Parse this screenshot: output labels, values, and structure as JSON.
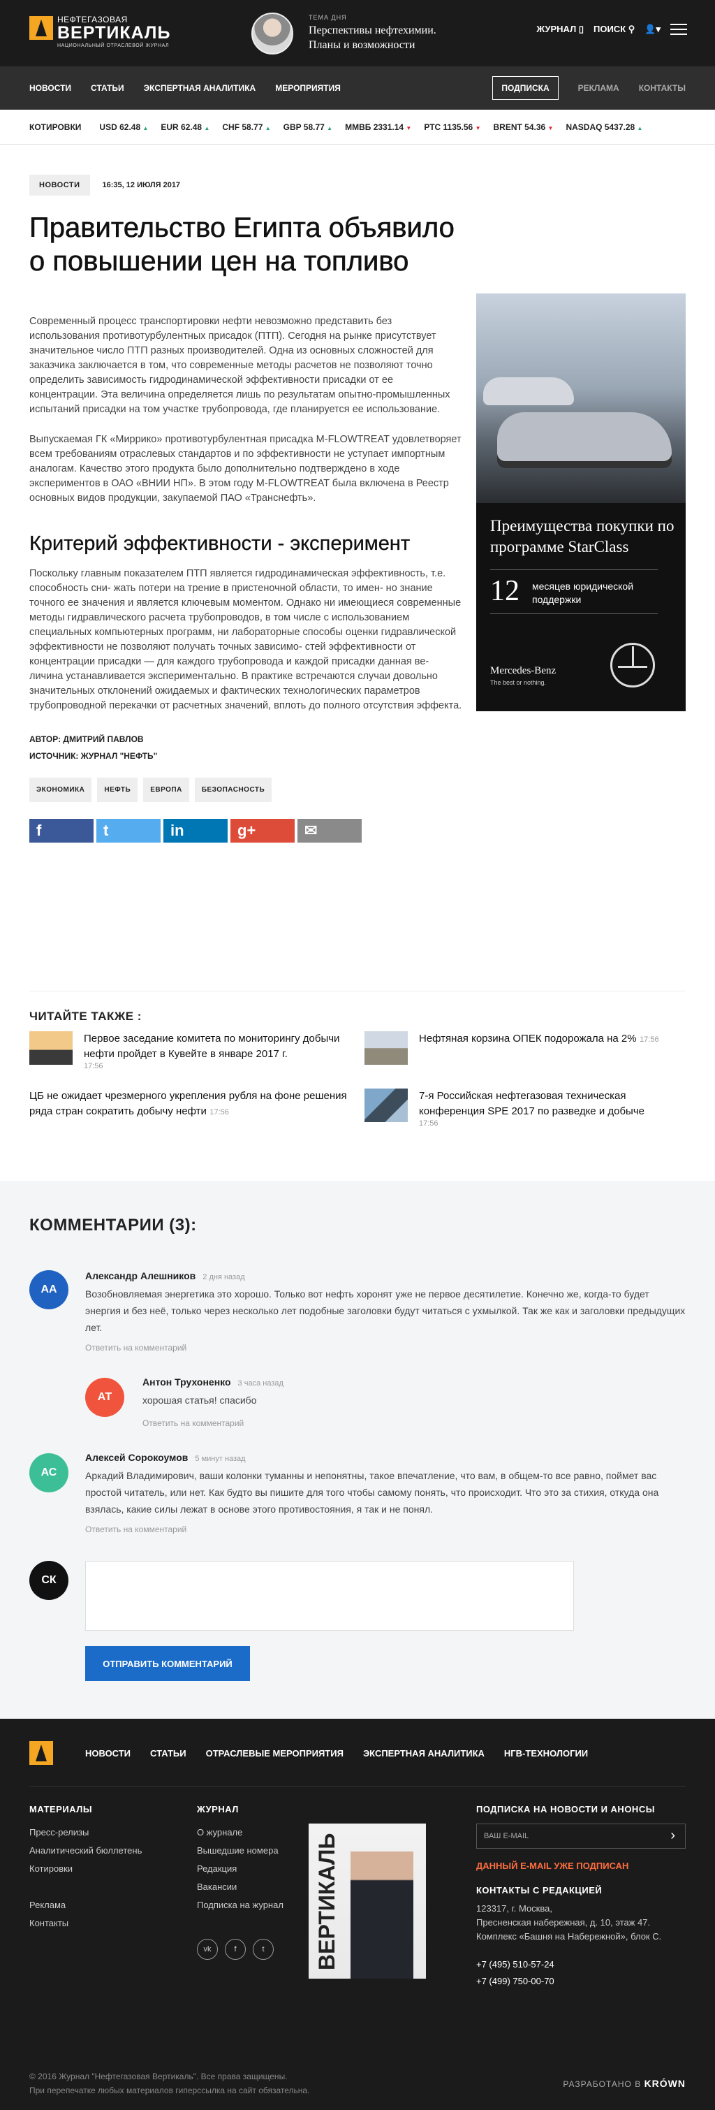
{
  "header": {
    "logo": {
      "line1": "НЕФТЕГАЗОВАЯ",
      "line2": "ВЕРТИКАЛЬ",
      "line3": "НАЦИОНАЛЬНЫЙ ОТРАСЛЕВОЙ ЖУРНАЛ"
    },
    "theme_label": "ТЕМА ДНЯ",
    "theme_text": "Перспективы нефтехимии. Планы и возможности",
    "journal": "ЖУРНАЛ",
    "search": "ПОИСК",
    "user_caret": "▾"
  },
  "nav": {
    "items": [
      "НОВОСТИ",
      "СТАТЬИ",
      "ЭКСПЕРТНАЯ АНАЛИТИКА",
      "МЕРОПРИЯТИЯ"
    ],
    "subscribe": "ПОДПИСКА",
    "ads": "РЕКЛАМА",
    "contacts": "КОНТАКТЫ"
  },
  "ticker": {
    "label": "КОТИРОВКИ",
    "items": [
      {
        "text": "USD 62.48",
        "dir": "▲",
        "up": true
      },
      {
        "text": "EUR 62.48",
        "dir": "▲",
        "up": true
      },
      {
        "text": "CHF 58.77",
        "dir": "▲",
        "up": true
      },
      {
        "text": "GBP 58.77",
        "dir": "▲",
        "up": true
      },
      {
        "text": "ММВБ 2331.14",
        "dir": "▼",
        "up": false
      },
      {
        "text": "РТС 1135.56",
        "dir": "▼",
        "up": false
      },
      {
        "text": "BRENT 54.36",
        "dir": "▼",
        "up": false
      },
      {
        "text": "NASDAQ 5437.28",
        "dir": "▲",
        "up": true
      }
    ]
  },
  "article": {
    "tag": "НОВОСТИ",
    "date": "16:35, 12 ИЮЛЯ 2017",
    "title": "Правительство Египта объявило о повышении цен на топливо",
    "p1": "Современный процесс транспортировки нефти невозможно представить без использования противотурбулентных присадок (ПТП). Сегодня на рынке присутствует значительное число ПТП разных производителей. Одна из основных сложностей для заказчика заключается в том, что современные методы расчетов не позволяют точно определить зависимость гидродинамической эффективности присадки от ее концентрации. Эта величина определяется лишь по результатам опытно-промышленных испытаний присадки на том участке трубопровода, где планируется ее использование.",
    "p2": "Выпускаемая ГК «Миррико» противотурбулентная присадка M-FLOWTREAT удовлетворяет всем требованиям отраслевых стандартов и по эффективности не уступает импортным аналогам. Качество этого продукта было дополнительно подтверждено в ходе экспериментов в ОАО «ВНИИ НП». В этом году M-FLOWTREAT была включена в Реестр основных видов продукции, закупаемой ПАО «Транснефть».",
    "h2": "Критерий эффективности - эксперимент",
    "p3": "Поскольку главным показателем ПТП является гидродинамическая эффективность, т.е. способность сни- жать потери на трение в пристеночной области, то имен- но знание точного ее значения и является ключевым моментом. Однако ни имеющиеся современные методы гидравлического расчета трубопроводов, в том числе с использованием специальных компьютерных программ, ни лабораторные способы оценки гидравлической эффективности не позволяют получать точных зависимо- стей эффективности от концентрации присадки — для каждого трубопровода и каждой присадки данная ве- личина устанавливается экспериментально. В практике встречаются случаи довольно значительных отклонений ожидаемых и фактических технологических параметров трубопроводной перекачки от расчетных значений, вплоть до полного отсутствия эффекта.",
    "author": "АВТОР: ДМИТРИЙ ПАВЛОВ",
    "source": "ИСТОЧНИК: ЖУРНАЛ \"НЕФТЬ\"",
    "tags": [
      "ЭКОНОМИКА",
      "НЕФТЬ",
      "ЕВРОПА",
      "БЕЗОПАСНОСТЬ"
    ],
    "shares": [
      {
        "glyph": "f",
        "color": "#3b5998"
      },
      {
        "glyph": "t",
        "color": "#55acee"
      },
      {
        "glyph": "in",
        "color": "#0077b5"
      },
      {
        "glyph": "g+",
        "color": "#dd4b39"
      },
      {
        "glyph": "✉",
        "color": "#8a8a8a"
      }
    ]
  },
  "ad": {
    "title": "Преимущества покупки по программе StarClass",
    "number": "12",
    "number_text": "месяцев юридической поддержки",
    "brand": "Mercedes-Benz",
    "slogan": "The best or nothing."
  },
  "read_also": {
    "title": "ЧИТАЙТЕ ТАКЖЕ :",
    "items": [
      {
        "title": "Первое заседание комитета по мониторингу добычи нефти пройдет в Кувейте в январе 2017 г.",
        "time": "17:56"
      },
      {
        "title": "Нефтяная корзина ОПЕК подорожала на 2%",
        "time": "17:56"
      },
      {
        "title": "ЦБ не ожидает чрезмерного укрепления рубля на фоне решения ряда стран сократить добычу нефти",
        "time": "17:56"
      },
      {
        "title": "7-я Российская нефтегазовая техническая конференция SPE 2017 по разведке и добыче",
        "time": "17:56"
      }
    ]
  },
  "comments": {
    "title": "КОММЕНТАРИИ (3):",
    "reply": "Ответить на комментарий",
    "list": [
      {
        "initials": "АА",
        "name": "Александр Алешников",
        "time": "2 дня назад",
        "text": "Возобновляемая энергетика это хорошо. Только вот нефть хоронят уже не первое десятилетие. Конечно же, когда-то будет энергия и без неё, только через несколько лет подобные заголовки будут читаться с ухмылкой. Так же как и заголовки предыдущих лет.",
        "color": "#1f62c2"
      },
      {
        "initials": "АТ",
        "name": "Антон Трухоненко",
        "time": "3 часа назад",
        "text": "хорошая статья! спасибо",
        "color": "#f0543c"
      },
      {
        "initials": "АС",
        "name": "Алексей Сорокоумов",
        "time": "5 минут назад",
        "text": "Аркадий Владимирович, ваши колонки туманны и непонятны, такое впечатление, что вам, в общем-то все равно, поймет вас простой читатель, или нет. Как будто вы пишите для того чтобы самому понять, что происходит. Что это за стихия, откуда она взялась, какие силы лежат в основе этого противостояния, я так и не понял.",
        "color": "#3cbf96"
      }
    ],
    "me_initials": "СК",
    "submit": "ОТПРАВИТЬ КОММЕНТАРИЙ"
  },
  "footer": {
    "nav": [
      "НОВОСТИ",
      "СТАТЬИ",
      "ОТРАСЛЕВЫЕ МЕРОПРИЯТИЯ",
      "ЭКСПЕРТНАЯ АНАЛИТИКА",
      "НГВ-ТЕХНОЛОГИИ"
    ],
    "materials_title": "МАТЕРИАЛЫ",
    "materials": [
      "Пресс-релизы",
      "Аналитический бюллетень",
      "Котировки"
    ],
    "materials2": [
      "Реклама",
      "Контакты"
    ],
    "journal_title": "ЖУРНАЛ",
    "journal": [
      "О журнале",
      "Вышедшие номера",
      "Редакция",
      "Вакансии",
      "Подписка на журнал"
    ],
    "social": [
      "vk",
      "f",
      "t"
    ],
    "magazine_title": "ВЕРТИКАЛЬ",
    "subscribe_title": "ПОДПИСКА НА НОВОСТИ И АНОНСЫ",
    "email_placeholder": "ВАШ E-MAIL",
    "email_error": "ДАННЫЙ E-MAIL УЖЕ ПОДПИСАН",
    "contacts_title": "КОНТАКТЫ С РЕДАКЦИЕЙ",
    "address": [
      "123317, г. Москва,",
      "Пресненская набережная, д. 10, этаж 47.",
      "Комплекс «Башня на Набережной», блок С."
    ],
    "phones": [
      "+7 (495) 510-57-24",
      "+7 (499) 750-00-70"
    ],
    "copyright": "© 2016 Журнал \"Нефтегазовая Вертикаль\". Все права защищены.",
    "copy2": "При перепечатке любых материалов гиперссылка на сайт обязательна.",
    "dev_label": "РАЗРАБОТАНО В",
    "dev_brand": "KRÓWN"
  }
}
